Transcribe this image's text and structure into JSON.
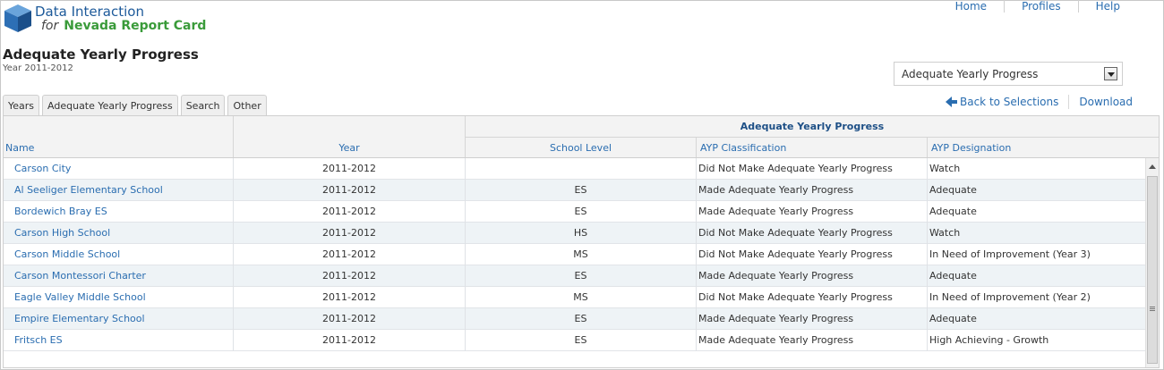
{
  "brand": {
    "line1": "Data Interaction",
    "for": "for",
    "line2": "Nevada Report Card"
  },
  "topnav": [
    "Home",
    "Profiles",
    "Help"
  ],
  "page": {
    "title": "Adequate Yearly Progress",
    "subtitle": "Year 2011-2012"
  },
  "dropdown": {
    "selected": "Adequate Yearly Progress"
  },
  "actions": {
    "back": "Back to Selections",
    "download": "Download"
  },
  "tabs": [
    "Years",
    "Adequate Yearly Progress",
    "Search",
    "Other"
  ],
  "table": {
    "group_header": "Adequate Yearly Progress",
    "columns": [
      "Name",
      "Year",
      "School Level",
      "AYP Classification",
      "AYP Designation"
    ],
    "rows": [
      [
        "Carson City",
        "2011-2012",
        "",
        "Did Not Make Adequate Yearly Progress",
        "Watch"
      ],
      [
        "Al Seeliger Elementary School",
        "2011-2012",
        "ES",
        "Made Adequate Yearly Progress",
        "Adequate"
      ],
      [
        "Bordewich Bray ES",
        "2011-2012",
        "ES",
        "Made Adequate Yearly Progress",
        "Adequate"
      ],
      [
        "Carson High School",
        "2011-2012",
        "HS",
        "Did Not Make Adequate Yearly Progress",
        "Watch"
      ],
      [
        "Carson Middle School",
        "2011-2012",
        "MS",
        "Did Not Make Adequate Yearly Progress",
        "In Need of Improvement (Year 3)"
      ],
      [
        "Carson Montessori Charter",
        "2011-2012",
        "ES",
        "Made Adequate Yearly Progress",
        "Adequate"
      ],
      [
        "Eagle Valley Middle School",
        "2011-2012",
        "MS",
        "Did Not Make Adequate Yearly Progress",
        "In Need of Improvement (Year 2)"
      ],
      [
        "Empire Elementary School",
        "2011-2012",
        "ES",
        "Made Adequate Yearly Progress",
        "Adequate"
      ],
      [
        "Fritsch ES",
        "2011-2012",
        "ES",
        "Made Adequate Yearly Progress",
        "High Achieving - Growth"
      ]
    ]
  },
  "colors": {
    "link": "#2a6db0",
    "brand_green": "#3a9b3a",
    "row_alt": "#eef3f6"
  }
}
